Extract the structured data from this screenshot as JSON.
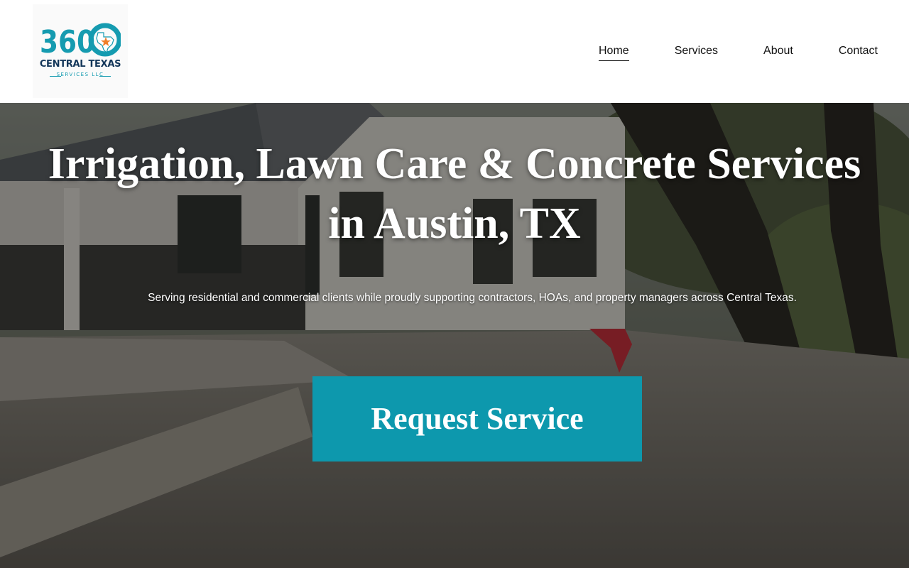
{
  "header": {
    "logo": {
      "mark_text": "360",
      "line1": "CENTRAL TEXAS",
      "line2": "SERVICES LLC",
      "icon": "texas-star-icon",
      "colors": {
        "teal": "#159bb0",
        "navy": "#14375a",
        "star": "#f07f2a"
      }
    },
    "nav": {
      "items": [
        {
          "label": "Home",
          "active": true
        },
        {
          "label": "Services",
          "active": false
        },
        {
          "label": "About",
          "active": false
        },
        {
          "label": "Contact",
          "active": false
        }
      ]
    }
  },
  "hero": {
    "title_line1": "Irrigation, Lawn Care & Concrete Services",
    "title_line2": "in Austin, TX",
    "subtitle": "Serving residential and commercial clients while proudly supporting contractors, HOAs, and property managers across Central Texas.",
    "cta_label": "Request Service",
    "cta_color": "#0d98ad"
  }
}
